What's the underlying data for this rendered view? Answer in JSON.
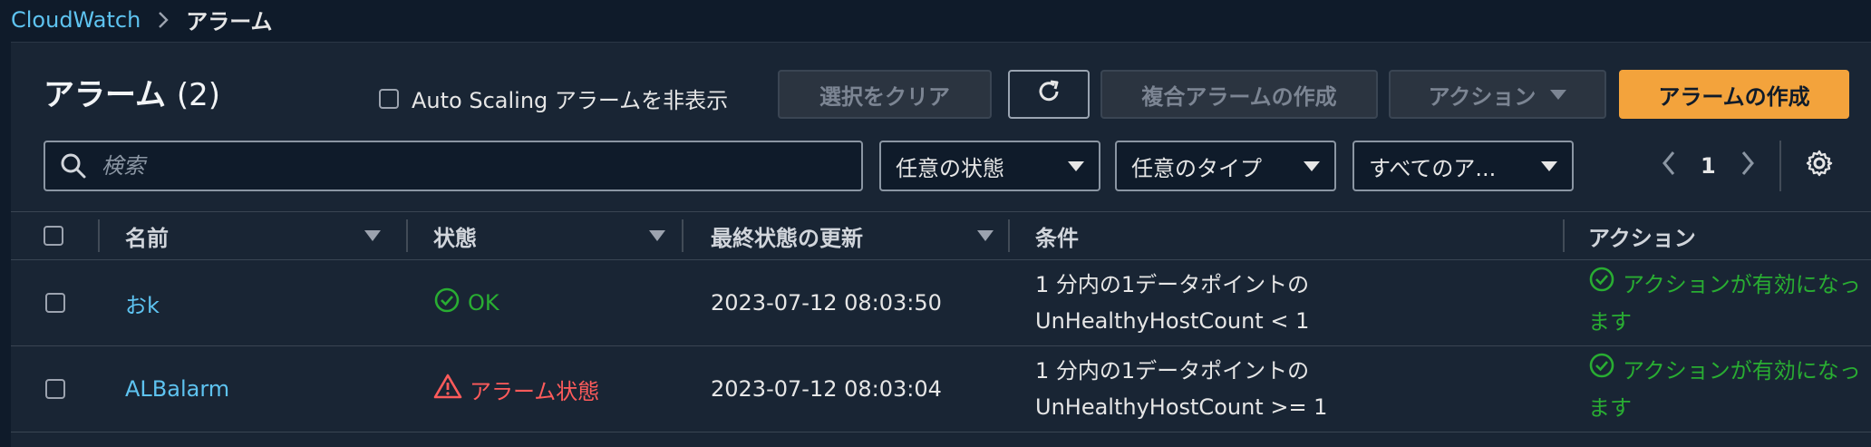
{
  "breadcrumb": {
    "root": "CloudWatch",
    "current": "アラーム"
  },
  "page": {
    "title": "アラーム",
    "count": "(2)"
  },
  "toolbar": {
    "hide_autoscaling_label": "Auto Scaling アラームを非表示",
    "clear_selection": "選択をクリア",
    "create_composite": "複合アラームの作成",
    "actions": "アクション",
    "create_alarm": "アラームの作成"
  },
  "filters": {
    "search_placeholder": "検索",
    "state": "任意の状態",
    "type": "任意のタイプ",
    "actions_filter": "すべてのア..."
  },
  "pagination": {
    "current_page": "1"
  },
  "table": {
    "headers": {
      "name": "名前",
      "state": "状態",
      "last_update": "最終状態の更新",
      "conditions": "条件",
      "actions": "アクション"
    },
    "rows": [
      {
        "name": "おk",
        "state": "OK",
        "last_update": "2023-07-12 08:03:50",
        "condition_line1": "1 分内の1データポイントの",
        "condition_line2": "UnHealthyHostCount < 1",
        "actions_line1": "アクションが有効になっ",
        "actions_line2": "ます"
      },
      {
        "name": "ALBalarm",
        "state": "アラーム状態",
        "last_update": "2023-07-12 08:03:04",
        "condition_line1": "1 分内の1データポイントの",
        "condition_line2": "UnHealthyHostCount >= 1",
        "actions_line1": "アクションが有効になっ",
        "actions_line2": "ます"
      }
    ]
  },
  "colors": {
    "accent": "#f3a33c",
    "link": "#5ec3f0",
    "ok": "#29ad32",
    "alarm": "#ff5b5b"
  }
}
